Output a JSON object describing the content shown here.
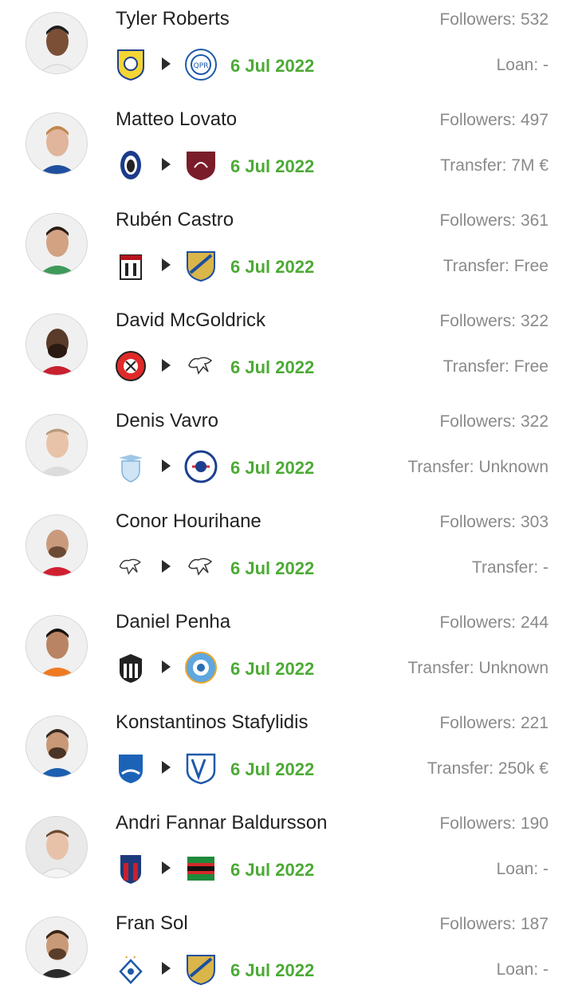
{
  "transfers": [
    {
      "name": "Tyler Roberts",
      "followers": "Followers: 532",
      "date": "6 Jul 2022",
      "fee": "Loan: -",
      "from_club": "leeds-crest-icon",
      "to_club": "qpr-crest-icon"
    },
    {
      "name": "Matteo Lovato",
      "followers": "Followers: 497",
      "date": "6 Jul 2022",
      "fee": "Transfer: 7M €",
      "from_club": "atalanta-crest-icon",
      "to_club": "salernitana-crest-icon"
    },
    {
      "name": "Rubén Castro",
      "followers": "Followers: 361",
      "date": "6 Jul 2022",
      "fee": "Transfer: Free",
      "from_club": "cartagena-crest-icon",
      "to_club": "malaga-crest-icon"
    },
    {
      "name": "David McGoldrick",
      "followers": "Followers: 322",
      "date": "6 Jul 2022",
      "fee": "Transfer: Free",
      "from_club": "sheffield-united-crest-icon",
      "to_club": "derby-crest-icon"
    },
    {
      "name": "Denis Vavro",
      "followers": "Followers: 322",
      "date": "6 Jul 2022",
      "fee": "Transfer: Unknown",
      "from_club": "lazio-crest-icon",
      "to_club": "copenhagen-crest-icon"
    },
    {
      "name": "Conor Hourihane",
      "followers": "Followers: 303",
      "date": "6 Jul 2022",
      "fee": "Transfer: -",
      "from_club": "derby-crest-icon",
      "to_club": "derby-crest-icon"
    },
    {
      "name": "Daniel Penha",
      "followers": "Followers: 244",
      "date": "6 Jul 2022",
      "fee": "Transfer: Unknown",
      "from_club": "atletico-mineiro-crest-icon",
      "to_club": "dibba-crest-icon"
    },
    {
      "name": "Konstantinos Stafylidis",
      "followers": "Followers: 221",
      "date": "6 Jul 2022",
      "fee": "Transfer: 250k €",
      "from_club": "hoffenheim-crest-icon",
      "to_club": "bochum-crest-icon"
    },
    {
      "name": "Andri Fannar Baldursson",
      "followers": "Followers: 190",
      "date": "6 Jul 2022",
      "fee": "Loan: -",
      "from_club": "bologna-crest-icon",
      "to_club": "nec-crest-icon"
    },
    {
      "name": "Fran Sol",
      "followers": "Followers: 187",
      "date": "6 Jul 2022",
      "fee": "Loan: -",
      "from_club": "dynamo-kyiv-crest-icon",
      "to_club": "malaga-crest-icon"
    }
  ],
  "colors": {
    "date": "#4caa35",
    "secondary_text": "#8a8a8a",
    "name_text": "#222222"
  }
}
